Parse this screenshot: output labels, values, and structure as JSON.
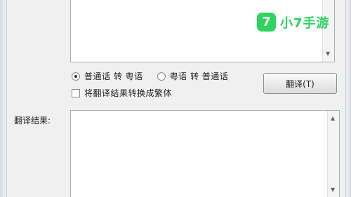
{
  "options": {
    "mandarin_to_cantonese": "普通话 转 粤语",
    "cantonese_to_mandarin": "粤语 转 普通话",
    "selected": "mandarin_to_cantonese",
    "convert_traditional": "将翻译结果转换成繁体"
  },
  "buttons": {
    "translate": "翻译(T)"
  },
  "labels": {
    "result": "翻译结果:"
  },
  "watermark": {
    "mark": "7",
    "text": "小7手游",
    "color": "#2fd35f"
  }
}
